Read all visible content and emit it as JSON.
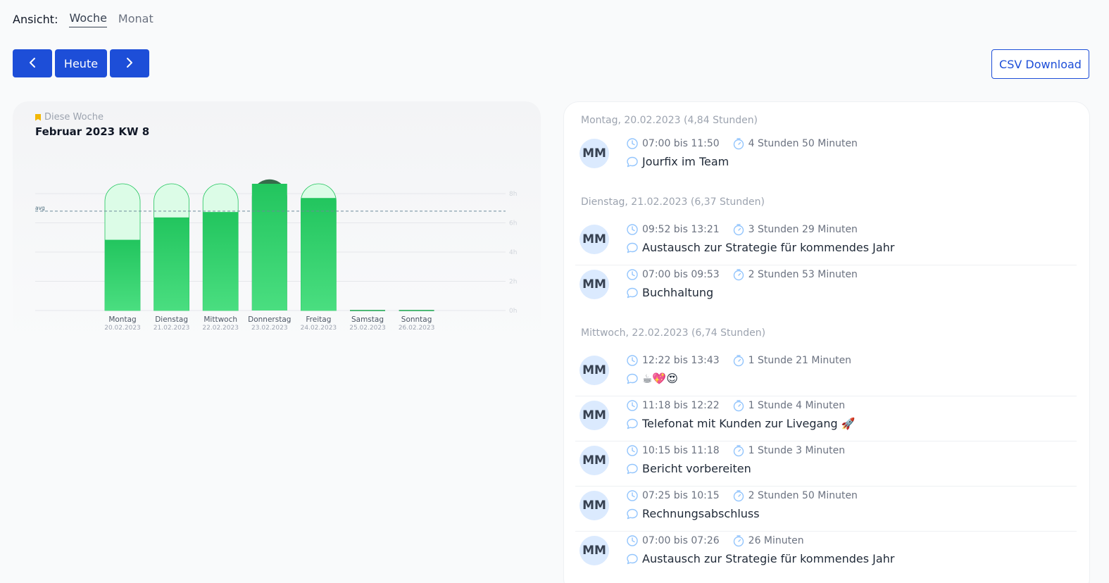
{
  "view": {
    "label": "Ansicht:",
    "options": [
      "Woche",
      "Monat"
    ]
  },
  "nav": {
    "prev_icon": "chevron-left-icon",
    "today_label": "Heute",
    "next_icon": "chevron-right-icon"
  },
  "csv_label": "CSV Download",
  "chart_card": {
    "subtitle": "Diese Woche",
    "title": "Februar 2023 KW 8"
  },
  "colors": {
    "primary": "#1d4ed8",
    "bar_green": "#22c55e",
    "bar_light": "#dcfce7",
    "bar_dark": "#14532d",
    "avatar_bg": "#dbeafe"
  },
  "chart_data": {
    "type": "bar",
    "categories": [
      "Montag",
      "Dienstag",
      "Mittwoch",
      "Donnerstag",
      "Freitag",
      "Samstag",
      "Sonntag"
    ],
    "dates": [
      "20.02.2023",
      "21.02.2023",
      "22.02.2023",
      "23.02.2023",
      "24.02.2023",
      "25.02.2023",
      "26.02.2023"
    ],
    "values": [
      4.84,
      6.37,
      6.74,
      8.3,
      7.7,
      0,
      0
    ],
    "target": 8,
    "avg": 6.8,
    "avg_label": "avg",
    "yticks": [
      "8h",
      "6h",
      "4h",
      "2h",
      "0h"
    ],
    "ylim": [
      0,
      8
    ]
  },
  "days": [
    {
      "header": "Montag, 20.02.2023 (4,84 Stunden)",
      "entries": [
        {
          "initials": "MM",
          "time": "07:00 bis 11:50",
          "duration": "4 Stunden 50 Minuten",
          "text": "Jourfix im Team"
        }
      ]
    },
    {
      "header": "Dienstag, 21.02.2023 (6,37 Stunden)",
      "entries": [
        {
          "initials": "MM",
          "time": "09:52 bis 13:21",
          "duration": "3 Stunden 29 Minuten",
          "text": "Austausch zur Strategie für kommendes Jahr"
        },
        {
          "initials": "MM",
          "time": "07:00 bis 09:53",
          "duration": "2 Stunden 53 Minuten",
          "text": "Buchhaltung"
        }
      ]
    },
    {
      "header": "Mittwoch, 22.02.2023 (6,74 Stunden)",
      "entries": [
        {
          "initials": "MM",
          "time": "12:22 bis 13:43",
          "duration": "1 Stunde 21 Minuten",
          "text": "☕💖😍"
        },
        {
          "initials": "MM",
          "time": "11:18 bis 12:22",
          "duration": "1 Stunde 4 Minuten",
          "text": "Telefonat mit Kunden zur Livegang 🚀"
        },
        {
          "initials": "MM",
          "time": "10:15 bis 11:18",
          "duration": "1 Stunde 3 Minuten",
          "text": "Bericht vorbereiten"
        },
        {
          "initials": "MM",
          "time": "07:25 bis 10:15",
          "duration": "2 Stunden 50 Minuten",
          "text": "Rechnungsabschluss"
        },
        {
          "initials": "MM",
          "time": "07:00 bis 07:26",
          "duration": "26 Minuten",
          "text": "Austausch zur Strategie für kommendes Jahr"
        }
      ]
    }
  ]
}
